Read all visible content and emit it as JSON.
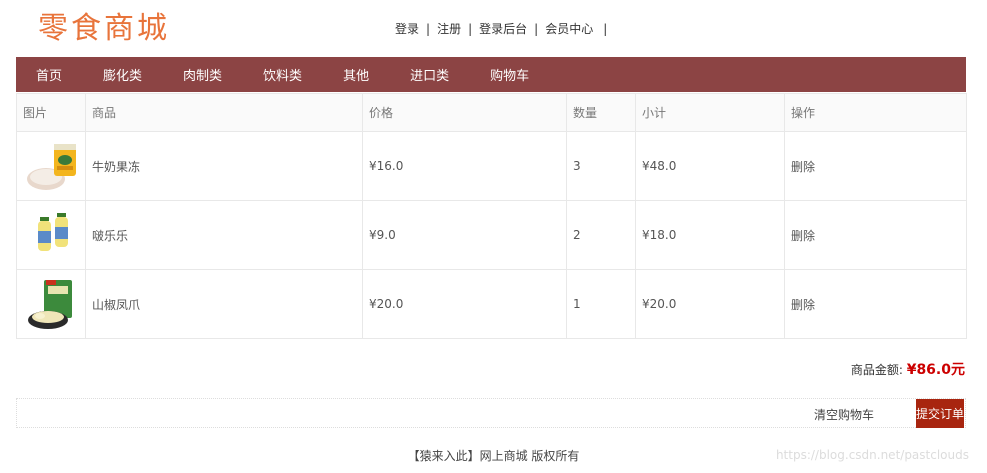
{
  "logo": "零食商城",
  "top_links": [
    {
      "label": "登录",
      "name": "login-link"
    },
    {
      "label": "注册",
      "name": "register-link"
    },
    {
      "label": "登录后台",
      "name": "admin-login-link"
    },
    {
      "label": "会员中心",
      "name": "member-center-link"
    }
  ],
  "top_sep": "|",
  "nav": [
    "首页",
    "膨化类",
    "肉制类",
    "饮料类",
    "其他",
    "进口类",
    "购物车"
  ],
  "cart": {
    "headers": [
      "图片",
      "商品",
      "价格",
      "数量",
      "小计",
      "操作"
    ],
    "rows": [
      {
        "name": "牛奶果冻",
        "price": "¥16.0",
        "qty": "3",
        "subtotal": "¥48.0",
        "action": "删除"
      },
      {
        "name": "啵乐乐",
        "price": "¥9.0",
        "qty": "2",
        "subtotal": "¥18.0",
        "action": "删除"
      },
      {
        "name": "山椒凤爪",
        "price": "¥20.0",
        "qty": "1",
        "subtotal": "¥20.0",
        "action": "删除"
      }
    ]
  },
  "total": {
    "label": "商品金额:",
    "amount": "¥86.0元"
  },
  "actions": {
    "clear": "清空购物车",
    "submit": "提交订单"
  },
  "footer": "【猿来入此】网上商城 版权所有",
  "watermark": "https://blog.csdn.net/pastclouds",
  "colors": {
    "accent": "#8c4444",
    "logo": "#e8743b",
    "submit": "#a8250f",
    "price": "#cc0000"
  }
}
